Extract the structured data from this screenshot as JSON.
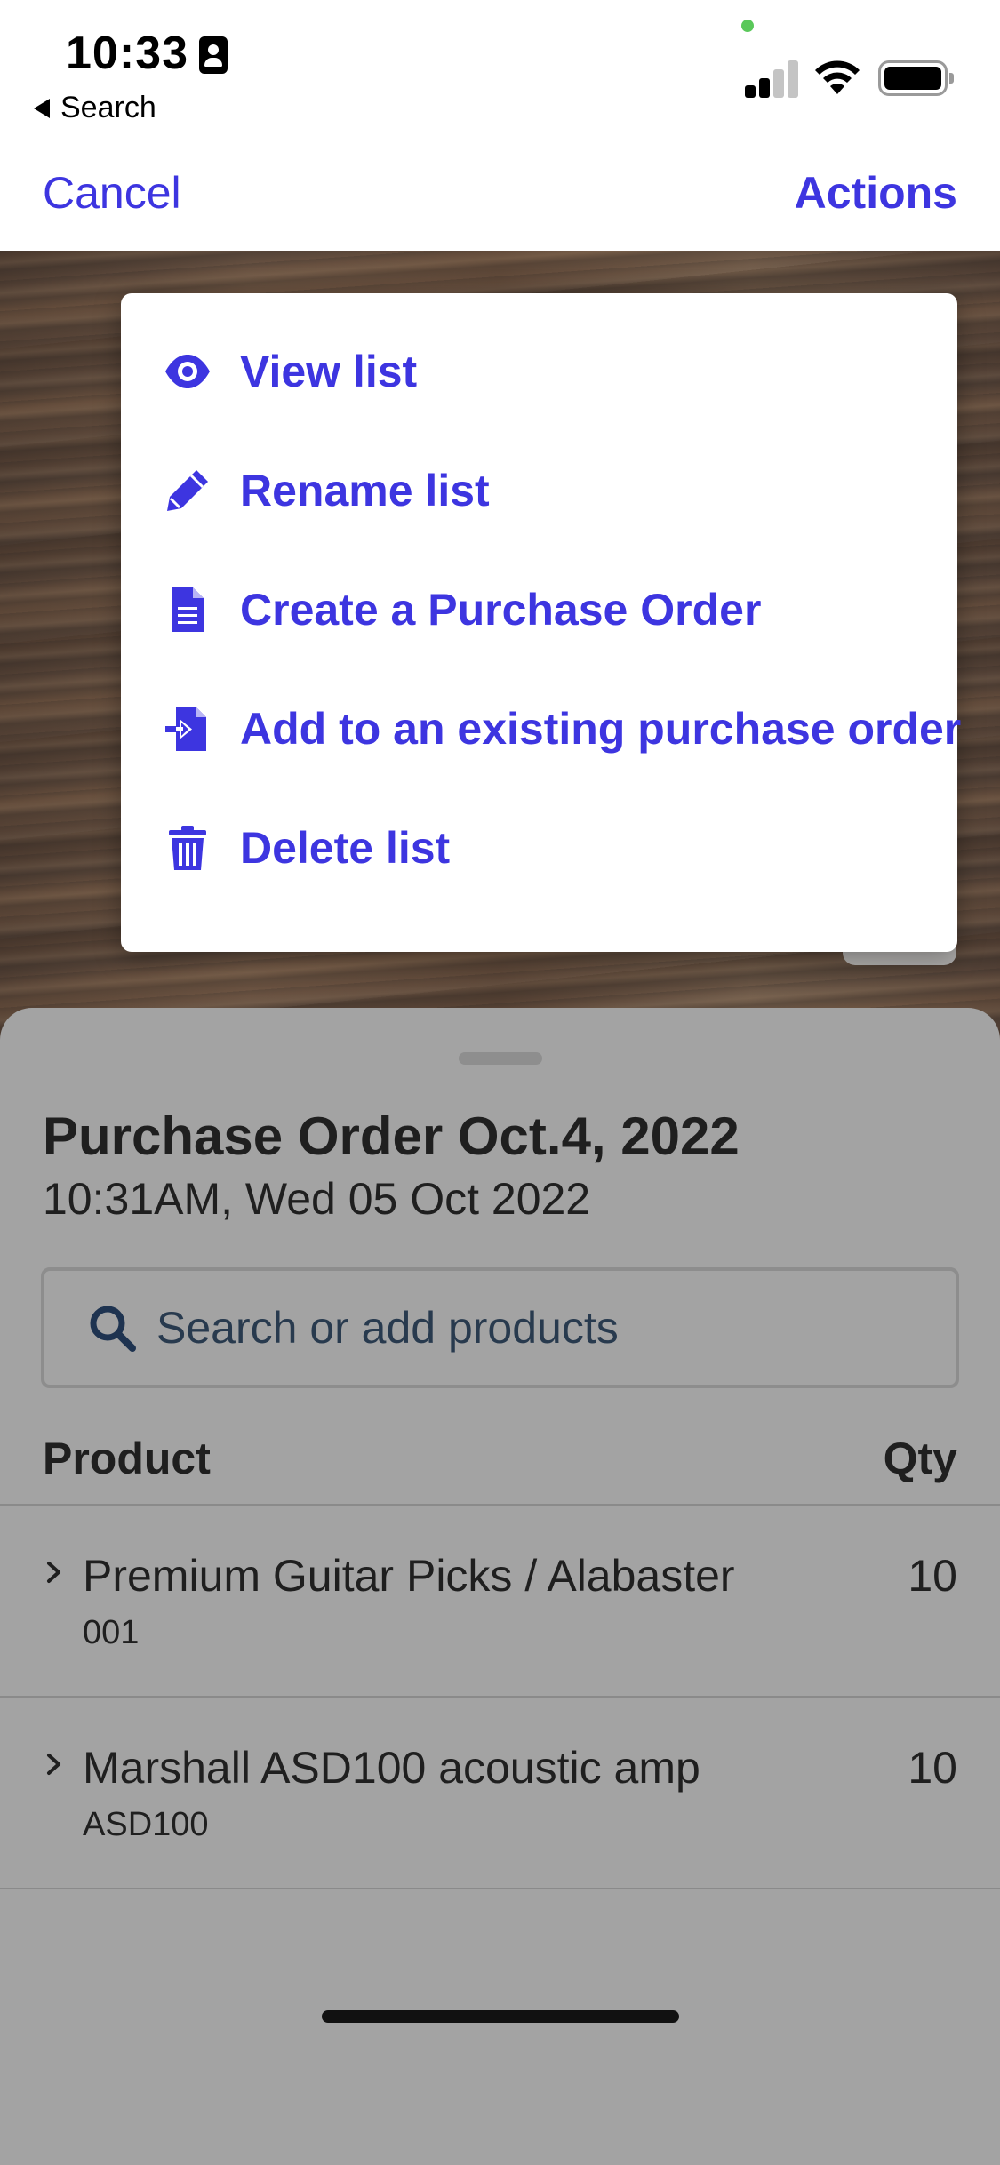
{
  "status_bar": {
    "time": "10:33",
    "back_label": "Search"
  },
  "nav": {
    "cancel": "Cancel",
    "actions": "Actions"
  },
  "menu": {
    "items": [
      {
        "label": "View list",
        "icon": "eye-icon"
      },
      {
        "label": "Rename list",
        "icon": "pencil-icon"
      },
      {
        "label": "Create a Purchase Order",
        "icon": "document-icon"
      },
      {
        "label": "Add to an existing purchase order",
        "icon": "file-import-icon"
      },
      {
        "label": "Delete list",
        "icon": "trash-icon"
      }
    ]
  },
  "sheet": {
    "title": "Purchase Order Oct.4, 2022",
    "subtitle": "10:31AM, Wed 05 Oct 2022",
    "search_placeholder": "Search or add products",
    "columns": {
      "product": "Product",
      "qty": "Qty"
    },
    "rows": [
      {
        "name": "Premium Guitar Picks / Alabaster",
        "sku": "001",
        "qty": "10"
      },
      {
        "name": "Marshall ASD100 acoustic amp",
        "sku": "ASD100",
        "qty": "10"
      }
    ]
  },
  "colors": {
    "accent": "#3d35e0",
    "sheet_background": "#a3a3a3",
    "menu_background": "#ffffff"
  }
}
